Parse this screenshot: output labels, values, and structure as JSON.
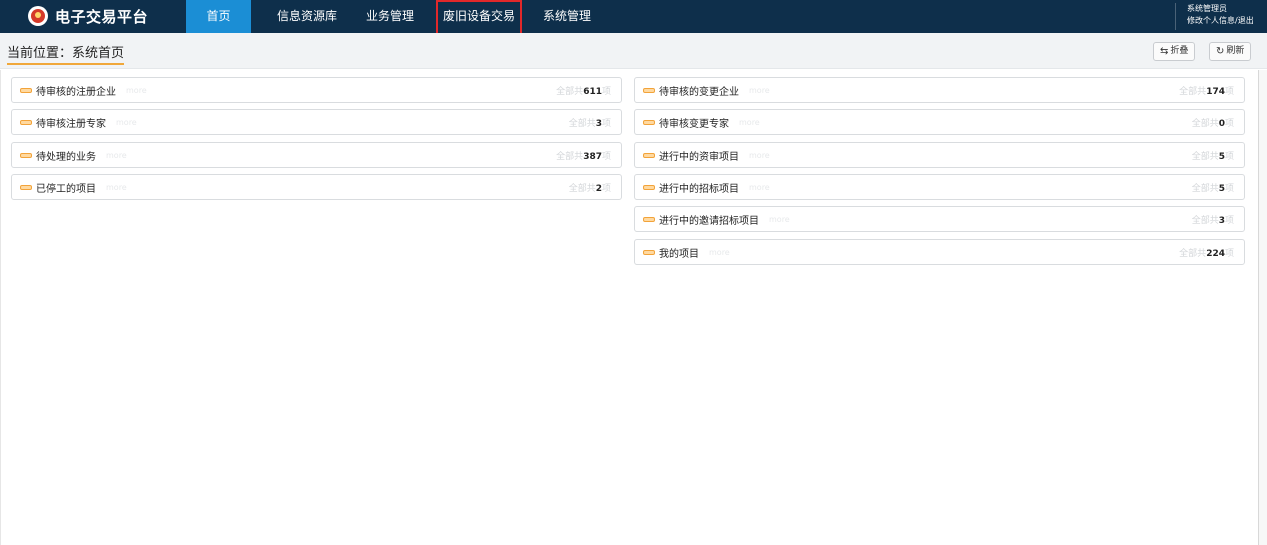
{
  "app": {
    "title": "电子交易平台"
  },
  "nav": {
    "items": [
      {
        "label": "首页"
      },
      {
        "label": "信息资源库"
      },
      {
        "label": "业务管理"
      },
      {
        "label": "废旧设备交易"
      },
      {
        "label": "系统管理"
      }
    ],
    "active_index": 0,
    "highlighted_index": 3
  },
  "user": {
    "role": "系统管理员",
    "links": "修改个人信息/退出"
  },
  "breadcrumb": {
    "text": "当前位置：系统首页"
  },
  "toolbar": {
    "collapse_label": "折叠",
    "refresh_label": "刷新"
  },
  "panels": {
    "left": [
      {
        "label": "待审核的注册企业",
        "ghost": "more",
        "prefix": "全部共",
        "count": "611",
        "suffix": "项"
      },
      {
        "label": "待审核注册专家",
        "ghost": "more",
        "prefix": "全部共",
        "count": "3",
        "suffix": "项"
      },
      {
        "label": "待处理的业务",
        "ghost": "more",
        "prefix": "全部共",
        "count": "387",
        "suffix": "项"
      },
      {
        "label": "已停工的项目",
        "ghost": "more",
        "prefix": "全部共",
        "count": "2",
        "suffix": "项"
      }
    ],
    "right": [
      {
        "label": "待审核的变更企业",
        "ghost": "more",
        "prefix": "全部共",
        "count": "174",
        "suffix": "项"
      },
      {
        "label": "待审核变更专家",
        "ghost": "more",
        "prefix": "全部共",
        "count": "0",
        "suffix": "项"
      },
      {
        "label": "进行中的资审项目",
        "ghost": "more",
        "prefix": "全部共",
        "count": "5",
        "suffix": "项"
      },
      {
        "label": "进行中的招标项目",
        "ghost": "more",
        "prefix": "全部共",
        "count": "5",
        "suffix": "项"
      },
      {
        "label": "进行中的邀请招标项目",
        "ghost": "more",
        "prefix": "全部共",
        "count": "3",
        "suffix": "项"
      },
      {
        "label": "我的项目",
        "ghost": "more",
        "prefix": "全部共",
        "count": "224",
        "suffix": "项"
      }
    ]
  },
  "colors": {
    "topbar": "#0e2f4b",
    "active_tab": "#1b8ed5",
    "highlight_box": "#e0282a",
    "accent": "#f0a73a"
  },
  "icons": {
    "logo": "emblem-icon",
    "item": "tag-icon",
    "collapse": "collapse-icon",
    "refresh": "refresh-icon"
  }
}
